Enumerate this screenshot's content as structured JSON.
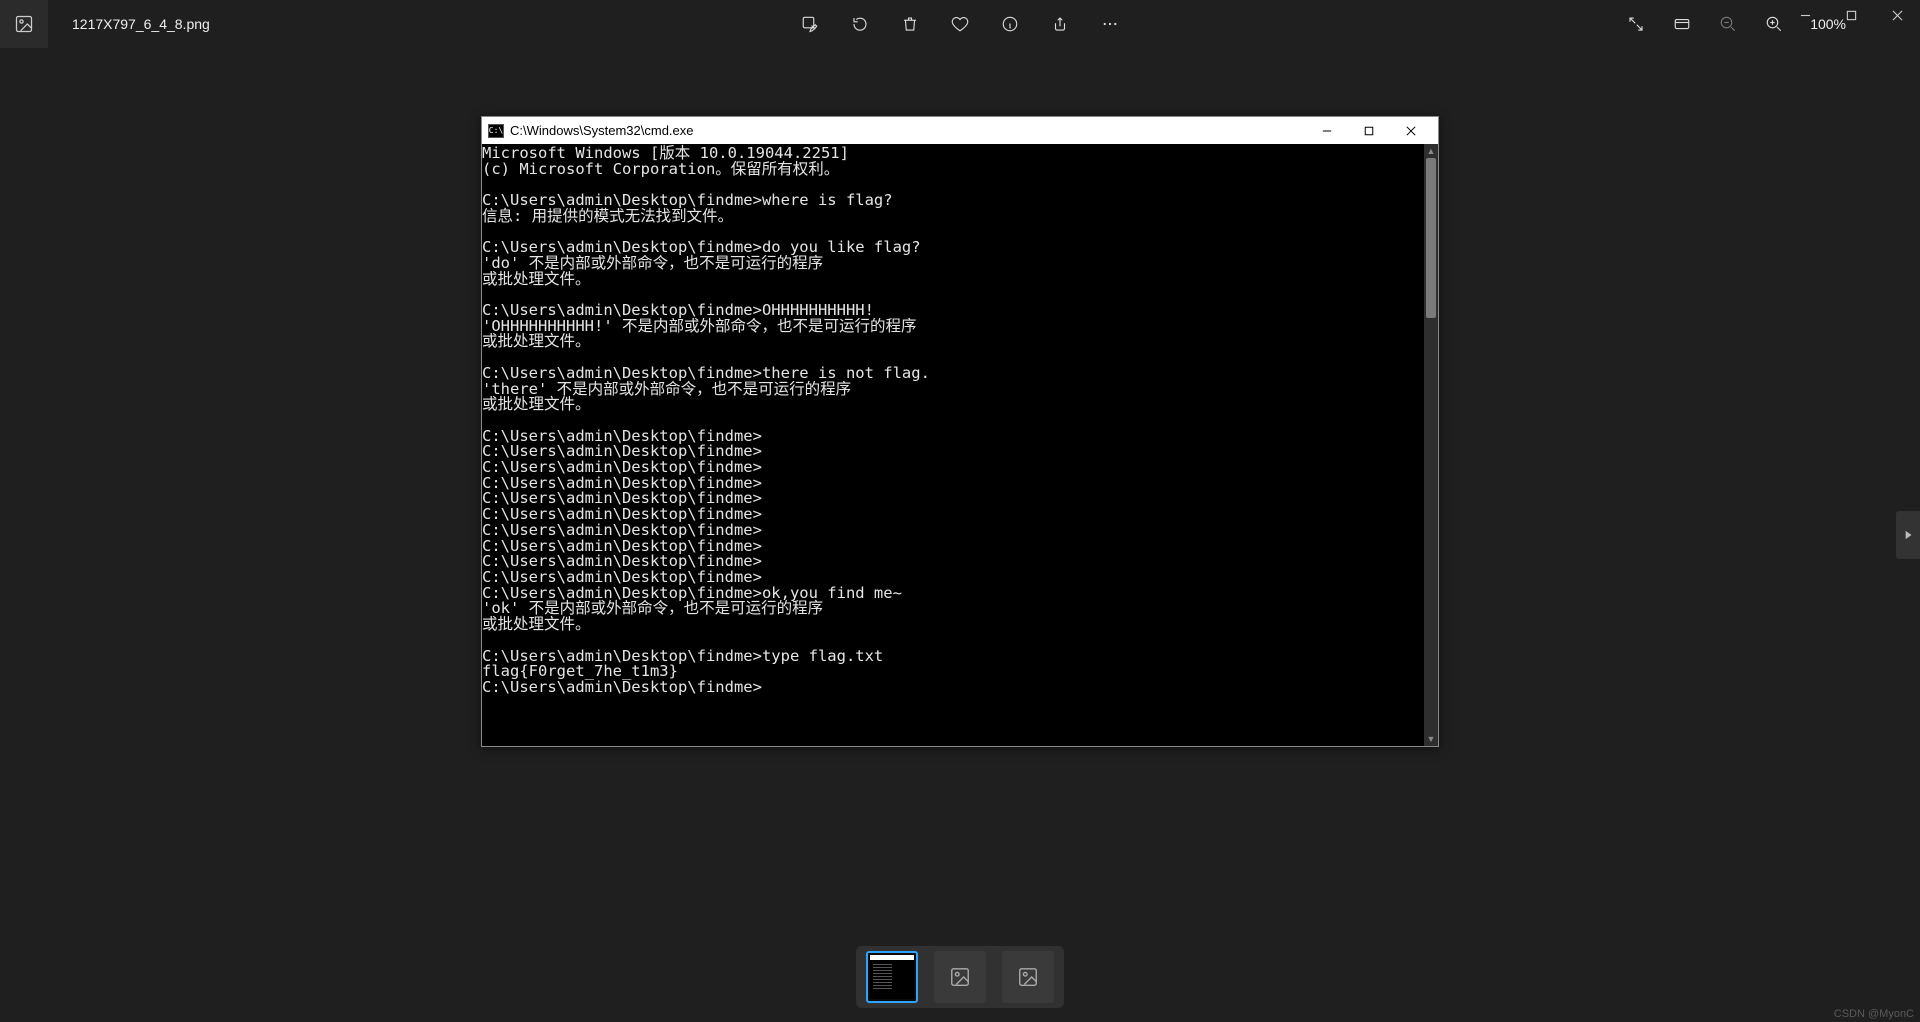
{
  "app": {
    "filename": "1217X797_6_4_8.png",
    "zoom_label": "100%"
  },
  "cmd": {
    "title": "C:\\Windows\\System32\\cmd.exe",
    "icon_label": "C:\\",
    "content": "Microsoft Windows [版本 10.0.19044.2251]\n(c) Microsoft Corporation。保留所有权利。\n\nC:\\Users\\admin\\Desktop\\findme>where is flag?\n信息: 用提供的模式无法找到文件。\n\nC:\\Users\\admin\\Desktop\\findme>do you like flag?\n'do' 不是内部或外部命令，也不是可运行的程序\n或批处理文件。\n\nC:\\Users\\admin\\Desktop\\findme>OHHHHHHHHHH!\n'OHHHHHHHHHH!' 不是内部或外部命令，也不是可运行的程序\n或批处理文件。\n\nC:\\Users\\admin\\Desktop\\findme>there is not flag.\n'there' 不是内部或外部命令，也不是可运行的程序\n或批处理文件。\n\nC:\\Users\\admin\\Desktop\\findme>\nC:\\Users\\admin\\Desktop\\findme>\nC:\\Users\\admin\\Desktop\\findme>\nC:\\Users\\admin\\Desktop\\findme>\nC:\\Users\\admin\\Desktop\\findme>\nC:\\Users\\admin\\Desktop\\findme>\nC:\\Users\\admin\\Desktop\\findme>\nC:\\Users\\admin\\Desktop\\findme>\nC:\\Users\\admin\\Desktop\\findme>\nC:\\Users\\admin\\Desktop\\findme>\nC:\\Users\\admin\\Desktop\\findme>ok,you find me~\n'ok' 不是内部或外部命令，也不是可运行的程序\n或批处理文件。\n\nC:\\Users\\admin\\Desktop\\findme>type flag.txt\nflag{F0rget_7he_t1m3}\nC:\\Users\\admin\\Desktop\\findme>"
  },
  "watermark": "CSDN @MyonC"
}
